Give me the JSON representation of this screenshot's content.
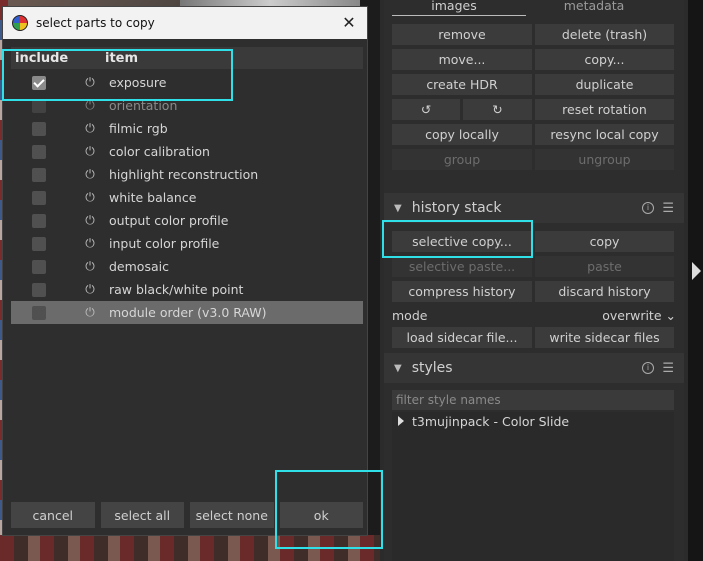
{
  "dialog": {
    "title": "select parts to copy",
    "col_include": "include",
    "col_item": "item",
    "items": [
      {
        "label": "exposure",
        "checked": true,
        "dim": false
      },
      {
        "label": "orientation",
        "checked": false,
        "dim": true
      },
      {
        "label": "filmic rgb",
        "checked": false,
        "dim": false
      },
      {
        "label": "color calibration",
        "checked": false,
        "dim": false
      },
      {
        "label": "highlight reconstruction",
        "checked": false,
        "dim": false
      },
      {
        "label": "white balance",
        "checked": false,
        "dim": false
      },
      {
        "label": "output color profile",
        "checked": false,
        "dim": false
      },
      {
        "label": "input color profile",
        "checked": false,
        "dim": false
      },
      {
        "label": "demosaic",
        "checked": false,
        "dim": false
      },
      {
        "label": "raw black/white point",
        "checked": false,
        "dim": false
      },
      {
        "label": "module order (v3.0 RAW)",
        "checked": false,
        "dim": false,
        "selected": true
      }
    ],
    "buttons": {
      "cancel": "cancel",
      "select_all": "select all",
      "select_none": "select none",
      "ok": "ok"
    },
    "close_glyph": "✕",
    "power_glyph": "⏻"
  },
  "panel": {
    "tabs": {
      "images": "images",
      "metadata": "metadata"
    },
    "images": {
      "remove": "remove",
      "delete": "delete (trash)",
      "move": "move...",
      "copy": "copy...",
      "create_hdr": "create HDR",
      "duplicate": "duplicate",
      "rotate_ccw": "↺",
      "rotate_cw": "↻",
      "reset_rotation": "reset rotation",
      "copy_locally": "copy locally",
      "resync": "resync local copy",
      "group": "group",
      "ungroup": "ungroup"
    },
    "history": {
      "title": "history stack",
      "selective_copy": "selective copy...",
      "copy": "copy",
      "selective_paste": "selective paste...",
      "paste": "paste",
      "compress": "compress history",
      "discard": "discard history",
      "mode_label": "mode",
      "mode_value": "overwrite",
      "load_sidecar": "load sidecar file...",
      "write_sidecar": "write sidecar files"
    },
    "styles": {
      "title": "styles",
      "filter_placeholder": "filter style names",
      "items": [
        "t3mujinpack - Color Slide"
      ]
    },
    "section_arrow": "▼",
    "info_glyph": "i",
    "menu_glyph": "☰"
  },
  "highlight_color": "#2fe0e8"
}
